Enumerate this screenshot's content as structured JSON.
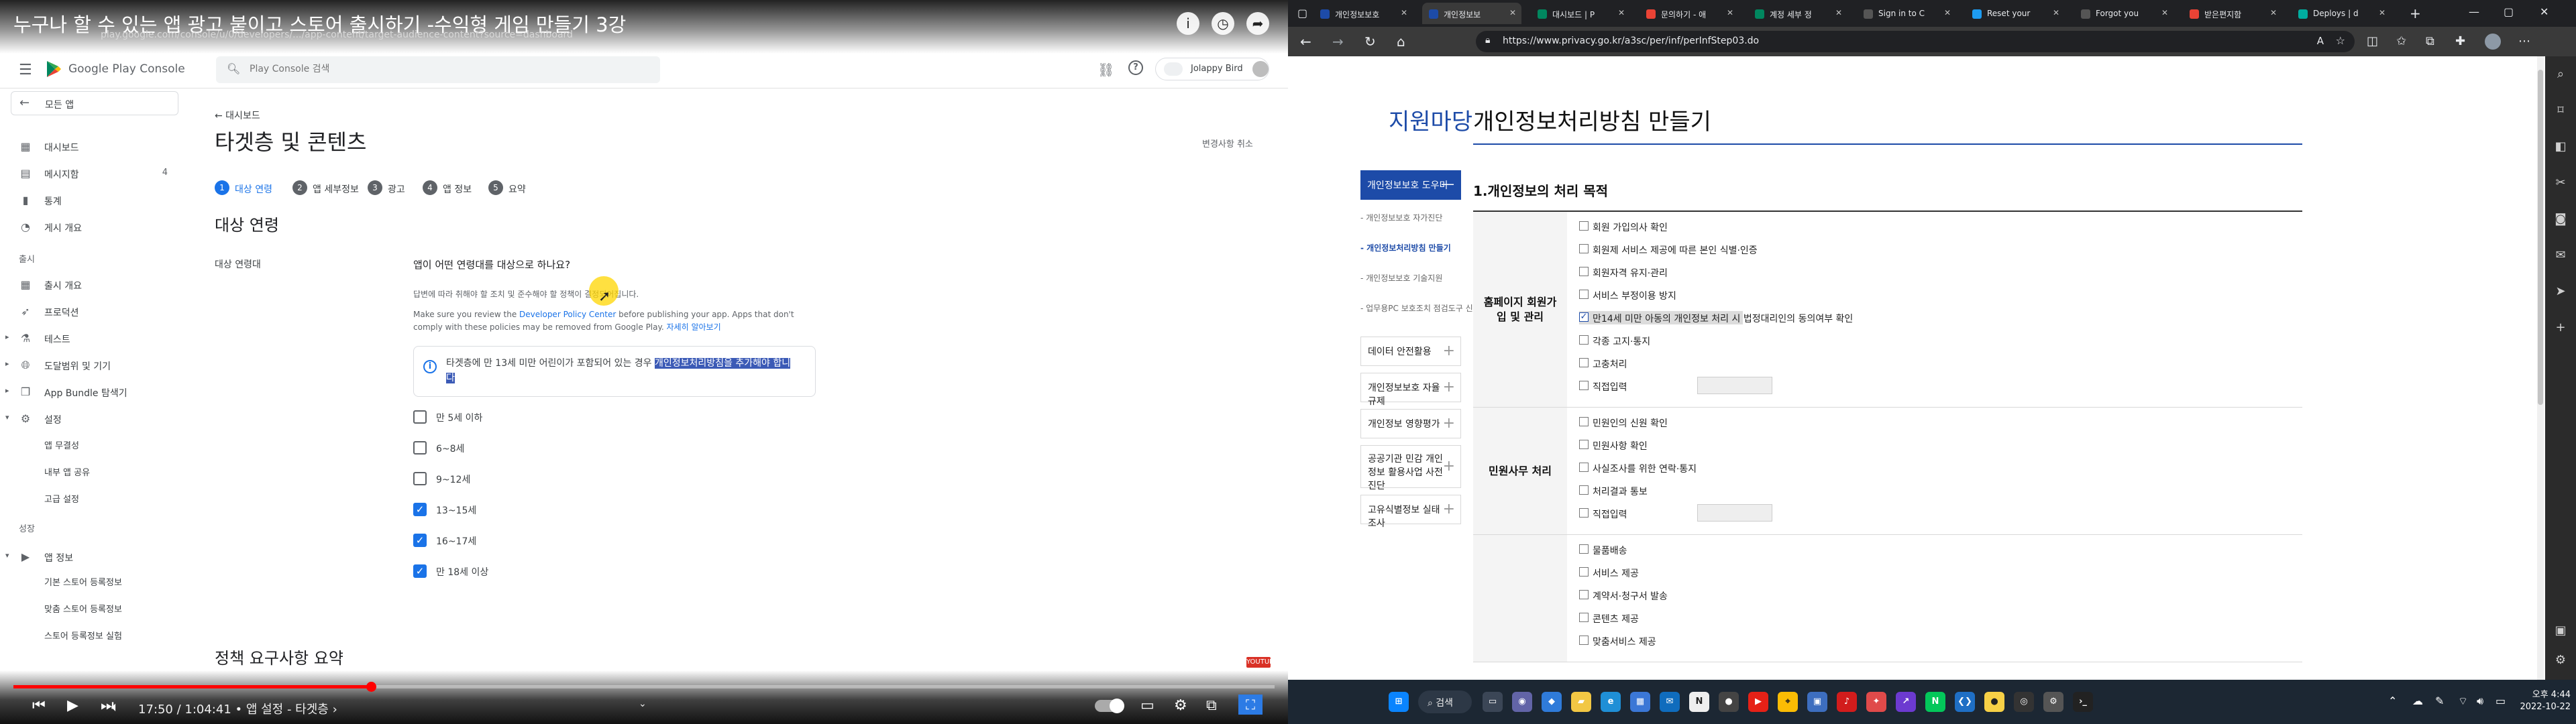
{
  "youtube": {
    "title": "누구나 할 수 있는 앱 광고 붙이고 스토어 출시하기 -수익형 게임 만들기 3강",
    "url": "play.google.com/console/u/0/developers/.../app-content/target-audience-content?source=dashboard",
    "progress": 0.2834,
    "time": "17:50 / 1:04:41 • 앱 설정 - 타겟층 ›",
    "top_icons": [
      "info-icon",
      "clock-icon",
      "share-icon"
    ],
    "controls": [
      "prev-icon",
      "play-icon",
      "next-icon",
      "volume-icon",
      "autoplay-toggle",
      "settings-icon",
      "miniplayer-icon",
      "theater-icon",
      "fullscreen-icon"
    ],
    "accent": "#ff0000"
  },
  "console": {
    "brand": "Google Play Console",
    "search_placeholder": "Play Console 검색",
    "account": "Jolappy Bird",
    "back": "모든 앱",
    "sidebar": {
      "main": [
        {
          "icon": "dashboard-icon",
          "label": "대시보드"
        },
        {
          "icon": "inbox-icon",
          "label": "메시지함",
          "badge": "4"
        },
        {
          "icon": "stats-icon",
          "label": "통계"
        },
        {
          "icon": "publish-icon",
          "label": "게시 개요"
        }
      ],
      "release_section": "출시",
      "release": [
        {
          "icon": "overview-icon",
          "label": "출시 개요"
        },
        {
          "icon": "rocket-icon",
          "label": "프로덕션"
        },
        {
          "icon": "test-icon",
          "label": "테스트"
        },
        {
          "icon": "reach-icon",
          "label": "도달범위 및 기기"
        },
        {
          "icon": "bundle-icon",
          "label": "App Bundle 탐색기"
        },
        {
          "icon": "settings-icon",
          "label": "설정"
        }
      ],
      "settings_sub": [
        "앱 무결성",
        "내부 앱 공유",
        "고급 설정"
      ],
      "grow_section": "성장",
      "grow": [
        {
          "icon": "store-icon",
          "label": "앱 정보"
        }
      ],
      "grow_sub": [
        "기본 스토어 등록정보",
        "맞춤 스토어 등록정보",
        "스토어 등록정보 실험"
      ]
    },
    "breadcrumb": "← 대시보드",
    "page_title": "타겟층 및 콘텐츠",
    "cancel": "변경사항 취소",
    "steps": [
      {
        "n": "1",
        "label": "대상 연령"
      },
      {
        "n": "2",
        "label": "앱 세부정보"
      },
      {
        "n": "3",
        "label": "광고"
      },
      {
        "n": "4",
        "label": "앱 정보"
      },
      {
        "n": "5",
        "label": "요약"
      }
    ],
    "section_title": "대상 연령",
    "row_label": "대상 연령대",
    "question": "앱이 어떤 연령대를 대상으로 하나요?",
    "desc1": "답변에 따라 취해야 할 조치 및 준수해야 할 정책이 결정되어집니다.",
    "desc2_a": "Make sure you review the ",
    "desc2_link": "Developer Policy Center",
    "desc2_b": " before publishing your app. Apps that don't comply with these policies may be removed from Google Play. ",
    "desc2_more": "자세히 알아보기",
    "info_a": "타겟층에 만 13세 미만 어린이가 포함되어 있는 경우 ",
    "info_sel": "개인정보처리방침을 추가해야 합니다",
    "ages": [
      {
        "label": "만 5세 이하",
        "checked": false
      },
      {
        "label": "6~8세",
        "checked": false
      },
      {
        "label": "9~12세",
        "checked": false
      },
      {
        "label": "13~15세",
        "checked": true
      },
      {
        "label": "16~17세",
        "checked": true
      },
      {
        "label": "만 18세 이상",
        "checked": true
      }
    ],
    "policy_title": "정책 요구사항 요약",
    "policy_flag": "YOUTUBE",
    "accent": "#1a73e8"
  },
  "edge": {
    "tabs": [
      {
        "title": "개인정보보호",
        "color": "#1d4ba8"
      },
      {
        "title": "개인정보보",
        "color": "#1d4ba8",
        "active": true
      },
      {
        "title": "대시보드 | P",
        "color": "#01875f"
      },
      {
        "title": "문의하기 - 애",
        "color": "#ea4335"
      },
      {
        "title": "계정 세부 정",
        "color": "#01875f"
      },
      {
        "title": "Sign in to C",
        "color": "#555555"
      },
      {
        "title": "Reset your",
        "color": "#1d9bf0"
      },
      {
        "title": "Forgot you",
        "color": "#555555"
      },
      {
        "title": "받은편지함",
        "color": "#ea4335"
      },
      {
        "title": "Deploys | d",
        "color": "#00ad9f"
      }
    ],
    "url": "https://www.privacy.go.kr/a3sc/per/inf/perInfStep03.do",
    "nav_icons": [
      "back-icon",
      "forward-icon",
      "refresh-icon",
      "home-icon"
    ],
    "toolbar_icons": [
      "read-aloud-icon",
      "favorite-icon",
      "collections-icon",
      "favorites-bar-icon",
      "split-screen-icon",
      "extensions-icon",
      "profile-icon",
      "more-icon"
    ],
    "sidebar_icons": [
      "search-icon",
      "tag-icon",
      "bag-icon",
      "tools-icon",
      "office-icon",
      "outlook-icon",
      "telegram-icon",
      "add-icon"
    ]
  },
  "privacy": {
    "side_title": "지원마당",
    "active_menu": "개인정보보호 도우미",
    "sub_items": [
      {
        "label": "- 개인정보보호 자가진단",
        "current": false
      },
      {
        "label": "- 개인정보처리방침 만들기",
        "current": true
      },
      {
        "label": "- 개인정보보호 기술지원",
        "current": false
      },
      {
        "label": "- 업무용PC 보호조치 점검도구 신청",
        "current": false
      }
    ],
    "menu": [
      "데이터 안전활용",
      "개인정보보호 자율규제",
      "개인정보 영향평가",
      "공공기관 민감 개인정보 활용사업 사전진단",
      "고유식별정보 실태조사"
    ],
    "title": "개인정보처리방침 만들기",
    "section": "1.개인정보의 처리 목적",
    "groups": [
      {
        "category": "홈페이지 회원가입 및 관리",
        "options": [
          {
            "label": "회원 가입의사 확인",
            "checked": false
          },
          {
            "label": "회원제 서비스 제공에 따른 본인 식별·인증",
            "checked": false
          },
          {
            "label": "회원자격 유지·관리",
            "checked": false
          },
          {
            "label": "서비스 부정이용 방지",
            "checked": false
          },
          {
            "label": "만14세 미만 아동의 개인정보 처리 시 법정대리인의 동의여부 확인",
            "checked": true,
            "highlight": true
          },
          {
            "label": "각종 고지·통지",
            "checked": false
          },
          {
            "label": "고충처리",
            "checked": false
          },
          {
            "label": "직접입력",
            "checked": false,
            "input": true
          }
        ]
      },
      {
        "category": "민원사무 처리",
        "options": [
          {
            "label": "민원인의 신원 확인",
            "checked": false
          },
          {
            "label": "민원사항 확인",
            "checked": false
          },
          {
            "label": "사실조사를 위한 연락·통지",
            "checked": false
          },
          {
            "label": "처리결과 통보",
            "checked": false
          },
          {
            "label": "직접입력",
            "checked": false,
            "input": true
          }
        ]
      },
      {
        "category": "",
        "options": [
          {
            "label": "물품배송",
            "checked": false
          },
          {
            "label": "서비스 제공",
            "checked": false
          },
          {
            "label": "계약서·청구서 발송",
            "checked": false
          },
          {
            "label": "콘텐츠 제공",
            "checked": false
          },
          {
            "label": "맞춤서비스 제공",
            "checked": false
          }
        ]
      }
    ],
    "accent": "#1d4ba8"
  },
  "taskbar": {
    "search": "검색",
    "apps": [
      {
        "icon": "windows-icon",
        "color": "#0a84ff",
        "glyph": "⊞"
      },
      {
        "icon": "taskview-icon",
        "color": "#3b4656",
        "glyph": "▭"
      },
      {
        "icon": "chat-icon",
        "color": "#6264a7",
        "glyph": "◉"
      },
      {
        "icon": "widgets-icon",
        "color": "#2f7bd9",
        "glyph": "◆"
      },
      {
        "icon": "explorer-icon",
        "color": "#f2c744",
        "glyph": "▰"
      },
      {
        "icon": "edge-icon",
        "color": "#1f8fd6",
        "glyph": "e"
      },
      {
        "icon": "store-icon",
        "color": "#3b77d6",
        "glyph": "▦"
      },
      {
        "icon": "mail-icon",
        "color": "#0f6cbd",
        "glyph": "✉"
      },
      {
        "icon": "notion-icon",
        "color": "#eeeeee",
        "glyph": "N"
      },
      {
        "icon": "spotify-icon",
        "color": "#444444",
        "glyph": "●"
      },
      {
        "icon": "youtube-icon",
        "color": "#e62117",
        "glyph": "▶"
      },
      {
        "icon": "maps-icon",
        "color": "#fbbc04",
        "glyph": "⌖"
      },
      {
        "icon": "app-icon",
        "color": "#3d6ebf",
        "glyph": "▣"
      },
      {
        "icon": "youtube-music-icon",
        "color": "#d21c1c",
        "glyph": "♪"
      },
      {
        "icon": "game-icon",
        "color": "#e04a4a",
        "glyph": "✦"
      },
      {
        "icon": "stock-icon",
        "color": "#6c3ad0",
        "glyph": "↗"
      },
      {
        "icon": "naver-icon",
        "color": "#03c75a",
        "glyph": "N"
      },
      {
        "icon": "vscode-icon",
        "color": "#1f6fc5",
        "glyph": "❮❯"
      },
      {
        "icon": "kakao-icon",
        "color": "#f7d046",
        "glyph": "●"
      },
      {
        "icon": "github-icon",
        "color": "#333333",
        "glyph": "◎"
      },
      {
        "icon": "settings-icon",
        "color": "#555555",
        "glyph": "⚙"
      },
      {
        "icon": "terminal-icon",
        "color": "#222222",
        "glyph": "›_"
      }
    ],
    "time": "오후 4:44",
    "date": "2022-10-22"
  }
}
